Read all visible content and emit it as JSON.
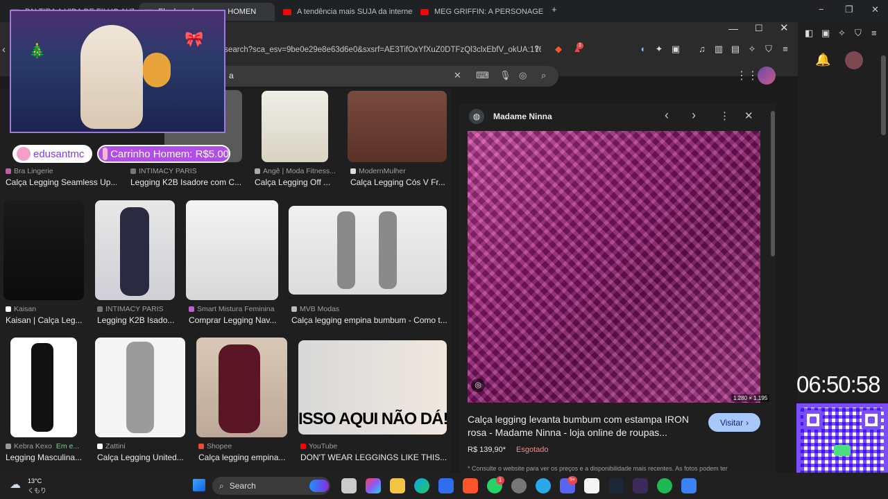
{
  "tabs": [
    {
      "label": "PAI TIRA A VIDA DE FILHO AUTISTA"
    },
    {
      "label": "Ela desenhou e sou HOMEN"
    },
    {
      "label": "A tendência mais SUJA da internet (R"
    },
    {
      "label": "MEG GRIFFIN: A PERSONAGEM MAIS"
    }
  ],
  "address": {
    "url": "/search?sca_esv=9be0e29e8e63d6e0&sxsrf=AE3TifOxYfXuZ0DTFzQl3clxEbfV_okUA:1763397..."
  },
  "ext_badge": "1",
  "search": {
    "query": "a"
  },
  "overlay": {
    "username": "edusantmc",
    "donation": "Carrinho Homem: R$5.00"
  },
  "results": [
    {
      "source": "Bra Lingerie",
      "title": "Calça Legging Seamless Up..."
    },
    {
      "source": "INTIMACY PARIS",
      "title": "Legging K2B Isadore com C..."
    },
    {
      "source": "Angê | Moda Fitness...",
      "title": "Calça Legging Off ..."
    },
    {
      "source": "ModernMulher",
      "title": "Calça Legging Cós V Fr..."
    },
    {
      "source": "Kaisan",
      "title": "Kaisan | Calça Leg..."
    },
    {
      "source": "INTIMACY PARIS",
      "title": "Legging K2B Isado..."
    },
    {
      "source": "Smart Mistura Feminina",
      "title": "Comprar Legging Nav..."
    },
    {
      "source": "MVB Modas",
      "title": "Calça legging empina bumbum - Como t..."
    },
    {
      "source": "Kebra Kexo",
      "source_extra": "Em e...",
      "title": "Legging Masculina..."
    },
    {
      "source": "Zattini",
      "title": "Calça Legging United..."
    },
    {
      "source": "Shopee",
      "title": "Calça legging empina..."
    },
    {
      "source": "YouTube",
      "title": "DON'T WEAR LEGGINGS LIKE THIS...."
    }
  ],
  "thumb_text": {
    "video_caption": "ISSO AQUI NÃO DÁ!"
  },
  "panel": {
    "site": "Madame Ninna",
    "dimensions": "1.280 × 1.195",
    "title_line1": "Calça legging levanta bumbum com estampa IRON",
    "title_line2": "rosa - Madame Ninna - loja online de roupas...",
    "price": "R$ 139,90*",
    "stock": "Esgotado",
    "visit_label": "Visitar",
    "note": "* Consulte o website para ver os preços e a disponibilidade mais recentes. As fotos podem ter"
  },
  "clock": {
    "time": "06:50:58"
  },
  "taskbar": {
    "temp": "13°C",
    "weather": "くもり",
    "search_label": "Search",
    "whatsapp_badge": "1",
    "discord_badge": "9+"
  },
  "colors": {
    "accent": "#a8c7fa",
    "stock_red": "#f28b82",
    "overlay_purple": "#7c4dff",
    "product_magenta": "#8e1f72"
  }
}
